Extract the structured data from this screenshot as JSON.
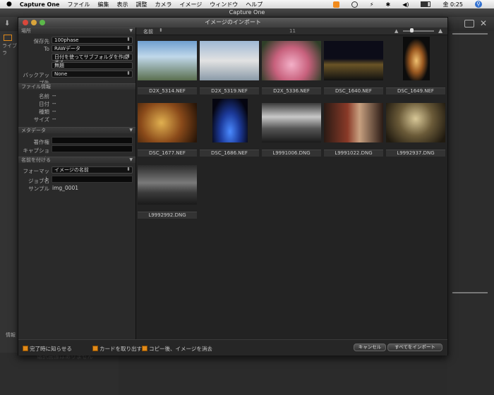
{
  "menubar": {
    "apple": "",
    "app": "Capture One",
    "items": [
      "ファイル",
      "編集",
      "表示",
      "調整",
      "カメラ",
      "イメージ",
      "ウィンドウ",
      "ヘルプ"
    ],
    "clock": "金 0:25"
  },
  "app": {
    "title": "Capture One"
  },
  "background": {
    "left_label": "ライブラ",
    "bottom_label": "情報",
    "bottom_text": "選択画像はありません"
  },
  "dialog": {
    "title": "イメージのインポート",
    "sort_label": "名前",
    "count": "11",
    "sidebar": {
      "location_header": "場所",
      "dest_label": "保存先",
      "dest_value": "100phase",
      "to_label": "To",
      "to_value": "RAWデータ",
      "subfolder_value": "日付を使ってサブフォルダを作成する",
      "subfolder_name": "無題",
      "backup_label": "バックアップ先",
      "backup_value": "None",
      "fileinfo_header": "ファイル情報",
      "name_label": "名前",
      "date_label": "日付",
      "kind_label": "種類",
      "size_label": "サイズ",
      "dash": "--",
      "metadata_header": "メタデータ",
      "author_label": "著作権",
      "caption_label": "キャプション",
      "naming_header": "名前を付ける",
      "format_label": "フォーマット",
      "format_value": "イメージの名前",
      "job_label": "ジョブ名",
      "sample_label": "サンプル",
      "sample_value": "img_0001"
    },
    "thumbnails": [
      {
        "name": "D2X_5314.NEF"
      },
      {
        "name": "D2X_5319.NEF"
      },
      {
        "name": "D2X_5336.NEF"
      },
      {
        "name": "DSC_1640.NEF"
      },
      {
        "name": "DSC_1649.NEF"
      },
      {
        "name": "DSC_1677.NEF"
      },
      {
        "name": "DSC_1686.NEF"
      },
      {
        "name": "L9991006.DNG"
      },
      {
        "name": "L9991022.DNG"
      },
      {
        "name": "L9992937.DNG"
      },
      {
        "name": "L9992992.DNG"
      }
    ],
    "footer": {
      "notify_label": "完了時に知らせる",
      "eject_label": "カードを取り出す",
      "erase_label": "コピー後、イメージを消去",
      "cancel_label": "キャンセル",
      "import_all_label": "すべてをインポート"
    }
  }
}
